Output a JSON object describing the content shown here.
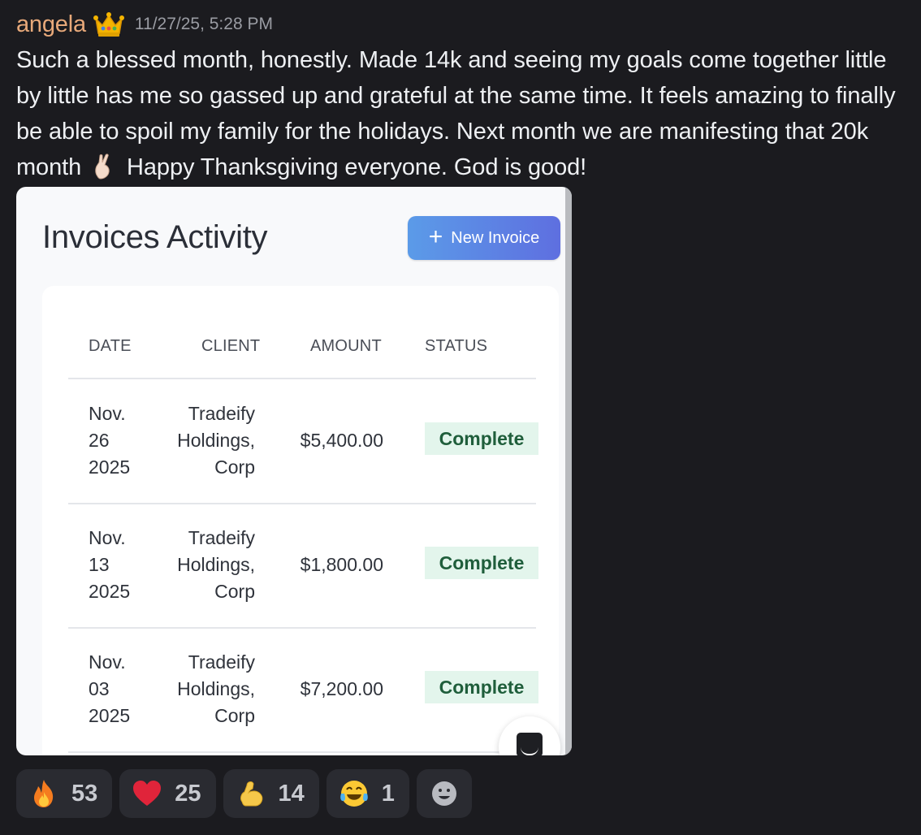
{
  "message": {
    "author": "angela",
    "author_badge_icon": "crown-icon",
    "timestamp": "11/27/25, 5:28 PM",
    "text_part1": "Such a blessed month, honestly. Made 14k and seeing my goals come together little by little has me so gassed up and grateful at the same time. It feels amazing to finally be able to spoil my family for the holidays. Next month we are manifesting that 20k month",
    "inline_emoji": "crossed-fingers-icon",
    "text_part2": "Happy Thanksgiving everyone. God is good!"
  },
  "attachment": {
    "title": "Invoices Activity",
    "new_invoice_label": "New Invoice",
    "columns": [
      "DATE",
      "CLIENT",
      "AMOUNT",
      "STATUS"
    ],
    "rows": [
      {
        "date_line1": "Nov.",
        "date_line2": "26",
        "date_line3": "2025",
        "client_line1": "Tradeify",
        "client_line2": "Holdings,",
        "client_line3": "Corp",
        "amount": "$5,400.00",
        "status": "Complete"
      },
      {
        "date_line1": "Nov.",
        "date_line2": "13",
        "date_line3": "2025",
        "client_line1": "Tradeify",
        "client_line2": "Holdings,",
        "client_line3": "Corp",
        "amount": "$1,800.00",
        "status": "Complete"
      },
      {
        "date_line1": "Nov.",
        "date_line2": "03",
        "date_line3": "2025",
        "client_line1": "Tradeify",
        "client_line2": "Holdings,",
        "client_line3": "Corp",
        "amount": "$7,200.00",
        "status": "Complete"
      }
    ],
    "status_color": "#e3f5ec",
    "button_gradient": [
      "#5b9be8",
      "#5e6fe0"
    ]
  },
  "reactions": [
    {
      "icon": "fire-icon",
      "count": "53"
    },
    {
      "icon": "red-heart-icon",
      "count": "25"
    },
    {
      "icon": "flexed-biceps-icon",
      "count": "14"
    },
    {
      "icon": "tears-of-joy-icon",
      "count": "1"
    }
  ],
  "add_reaction_icon": "add-reaction-icon",
  "colors": {
    "background": "#1b1b1f",
    "username": "#e8a97a",
    "reaction_bg": "#2a2b31"
  }
}
